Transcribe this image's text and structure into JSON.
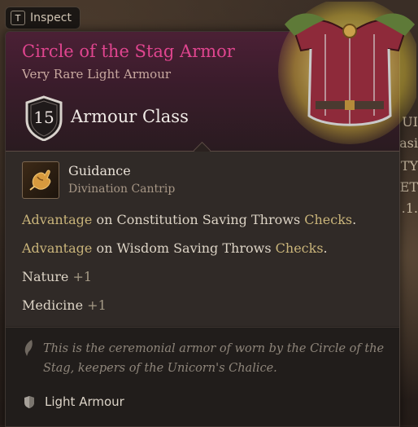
{
  "inspect": {
    "key": "T",
    "label": "Inspect"
  },
  "background_text": [
    "UI",
    "asi",
    "TY",
    "SET",
    ".1."
  ],
  "item": {
    "name": "Circle of the Stag Armor",
    "rarity_type": "Very Rare Light Armour",
    "armour_class_value": "15",
    "armour_class_label": "Armour Class",
    "name_color": "#e0458f"
  },
  "spell": {
    "name": "Guidance",
    "school": "Divination Cantrip",
    "icon": "guidance-hand-icon"
  },
  "properties": [
    {
      "keyword": "Advantage",
      "middle": " on Constitution Saving Throws ",
      "tail": "Checks",
      "end": "."
    },
    {
      "keyword": "Advantage",
      "middle": " on Wisdom Saving Throws ",
      "tail": "Checks",
      "end": "."
    }
  ],
  "skills": [
    {
      "name": "Nature",
      "bonus": "+1"
    },
    {
      "name": "Medicine",
      "bonus": "+1"
    }
  ],
  "flavor": "This is the ceremonial armor of worn by the Circle of the Stag, keepers of the Unicorn's Chalice.",
  "footer": {
    "type_label": "Light Armour",
    "icon": "armour-icon"
  }
}
